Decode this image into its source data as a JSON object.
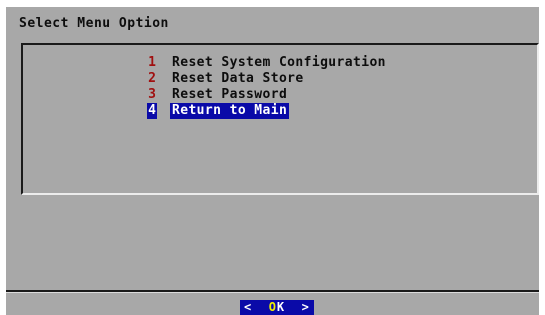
{
  "dialog": {
    "title": "Select Menu Option"
  },
  "menu": {
    "items": [
      {
        "number": "1",
        "label": "Reset System Configuration",
        "selected": false
      },
      {
        "number": "2",
        "label": "Reset Data Store",
        "selected": false
      },
      {
        "number": "3",
        "label": "Reset Password",
        "selected": false
      },
      {
        "number": "4",
        "label": "Return to Main",
        "selected": true
      }
    ]
  },
  "buttons": {
    "ok_left": "<",
    "ok_hotkey": "O",
    "ok_rest": "K",
    "ok_right": ">"
  },
  "colors": {
    "background": "#a8a8a8",
    "selection": "#0a0aa8",
    "item_number": "#a01010",
    "hotkey": "#f0f000"
  }
}
